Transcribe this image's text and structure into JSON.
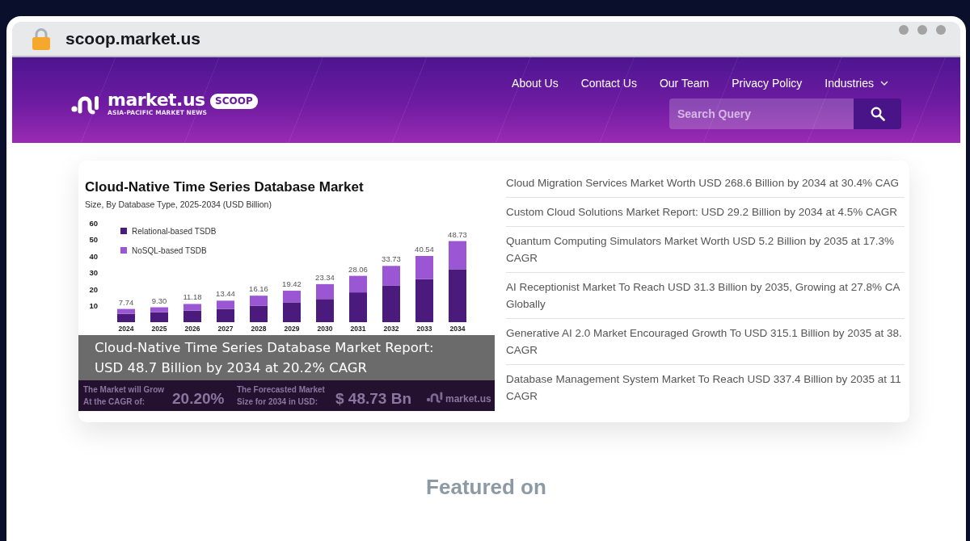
{
  "browser": {
    "url": "scoop.market.us"
  },
  "header": {
    "logo": {
      "wordmark": "market.us",
      "tagline": "ASIA-PACIFIC MARKET NEWS",
      "badge": "SCOOP"
    },
    "nav": [
      {
        "label": "About Us",
        "kind": "link"
      },
      {
        "label": "Contact Us",
        "kind": "link"
      },
      {
        "label": "Our Team",
        "kind": "link"
      },
      {
        "label": "Privacy Policy",
        "kind": "link"
      },
      {
        "label": "Industries",
        "kind": "dropdown"
      }
    ],
    "search": {
      "placeholder": "Search Query"
    }
  },
  "featured": {
    "image": {
      "subtitle": "Size, By Database Type, 2025-2034 (USD Billion)",
      "chart_data": {
        "type": "bar",
        "title": "Cloud-Native Time Series Database Market",
        "categories": [
          "2024",
          "2025",
          "2026",
          "2027",
          "2028",
          "2029",
          "2030",
          "2031",
          "2032",
          "2033",
          "2034"
        ],
        "series": [
          {
            "name": "Relational-based TSDB",
            "color": "#4a1a7c",
            "values": [
              5,
              6,
              7,
              8,
              10,
              12,
              14,
              18,
              22,
              26,
              32
            ]
          },
          {
            "name": "NoSQL-based TSDB",
            "color": "#9b57d3",
            "values": [
              3,
              3,
              4,
              5,
              6,
              7,
              9,
              10,
              12,
              14,
              17
            ]
          }
        ],
        "stacked": true,
        "legend": "upper left",
        "ylim": [
          0,
          60
        ],
        "yticks": [
          10,
          20,
          30,
          40,
          50,
          60
        ],
        "value_labels": [
          "7.74",
          "9.30",
          "11.18",
          "13.44",
          "16.16",
          "19.42",
          "23.34",
          "28.06",
          "33.73",
          "40.54",
          "48.73"
        ]
      },
      "footer": {
        "cagr_label": [
          "The Market will Grow",
          "At the CAGR of:"
        ],
        "cagr": "20.20%",
        "size_label": [
          "The Forecasted Market",
          "Size for 2034 in USD:"
        ],
        "size": "$ 48.73 Bn",
        "brand": "market.us"
      }
    },
    "caption": "Cloud-Native Time Series Database Market Report: USD 48.7 Billion by 2034 at 20.2% CAGR"
  },
  "related_posts": [
    {
      "lines": [
        "Cloud Migration Services Market Worth USD 268.6 Billion by 2034 at 30.4% CAG"
      ]
    },
    {
      "lines": [
        "Custom Cloud Solutions Market Report: USD 29.2 Billion by 2034 at 4.5% CAGR"
      ]
    },
    {
      "lines": [
        "Quantum Computing Simulators Market Worth USD 5.2 Billion by 2035 at 17.3%",
        "CAGR"
      ]
    },
    {
      "lines": [
        "AI Receptionist Market To Reach USD 31.3 Billion by 2035, Growing at 27.8% CA",
        "Globally"
      ]
    },
    {
      "lines": [
        "Generative AI 2.0 Market Encouraged Growth To USD 315.1 Billion by 2035 at 38.",
        "CAGR"
      ]
    },
    {
      "lines": [
        "Database Management System Market To Reach USD 337.4 Billion by 2035 at 11",
        "CAGR"
      ]
    }
  ],
  "featured_on": {
    "heading": "Featured on"
  }
}
